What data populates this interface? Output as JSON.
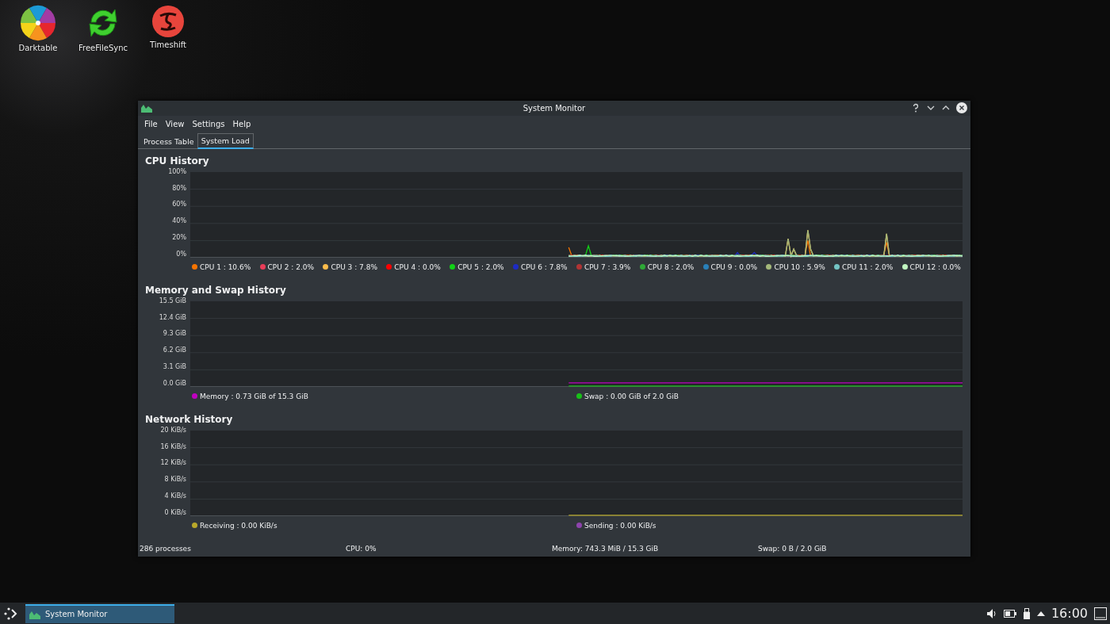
{
  "desktop_icons": [
    {
      "kind": "aperture",
      "label": "Darktable"
    },
    {
      "kind": "sync",
      "label": "FreeFileSync"
    },
    {
      "kind": "timeshift",
      "label": "Timeshift"
    }
  ],
  "window": {
    "title": "System Monitor"
  },
  "menu": [
    "File",
    "View",
    "Settings",
    "Help"
  ],
  "tabs": [
    {
      "label": "Process Table",
      "selected": false
    },
    {
      "label": "System Load",
      "selected": true
    }
  ],
  "panels": [
    {
      "kind": "cpu",
      "title": "CPU History",
      "y_labels": [
        "100%",
        "80%",
        "60%",
        "40%",
        "20%",
        "0%"
      ],
      "legend": [
        {
          "label": "CPU 1 : 10.6%",
          "color": "#f67400"
        },
        {
          "label": "CPU 2 : 2.0%",
          "color": "#e93d58"
        },
        {
          "label": "CPU 3 : 7.8%",
          "color": "#fdbc4b"
        },
        {
          "label": "CPU 4 : 0.0%",
          "color": "#ff0000"
        },
        {
          "label": "CPU 5 : 2.0%",
          "color": "#11d116"
        },
        {
          "label": "CPU 6 : 7.8%",
          "color": "#1d2bc4"
        },
        {
          "label": "CPU 7 : 3.9%",
          "color": "#b03434"
        },
        {
          "label": "CPU 8 : 2.0%",
          "color": "#2ea836"
        },
        {
          "label": "CPU 9 : 0.0%",
          "color": "#2980b9"
        },
        {
          "label": "CPU 10 : 5.9%",
          "color": "#a4b87a"
        },
        {
          "label": "CPU 11 : 2.0%",
          "color": "#73c4c4"
        },
        {
          "label": "CPU 12 : 0.0%",
          "color": "#c0f5c0"
        }
      ]
    },
    {
      "kind": "memory",
      "title": "Memory and Swap History",
      "y_labels": [
        "15.5 GiB",
        "12.4 GiB",
        "9.3 GiB",
        "6.2 GiB",
        "3.1 GiB",
        "0.0 GiB"
      ],
      "legend": [
        {
          "label": "Memory : 0.73 GiB of 15.3 GiB",
          "color": "#c000c0"
        },
        {
          "label": "Swap : 0.00 GiB of 2.0 GiB",
          "color": "#18c018"
        }
      ]
    },
    {
      "kind": "network",
      "title": "Network History",
      "y_labels": [
        "20 KiB/s",
        "16 KiB/s",
        "12 KiB/s",
        "8 KiB/s",
        "4 KiB/s",
        "0 KiB/s"
      ],
      "legend": [
        {
          "label": "Receiving : 0.00 KiB/s",
          "color": "#b8a82a"
        },
        {
          "label": "Sending : 0.00 KiB/s",
          "color": "#8e44ad"
        }
      ]
    }
  ],
  "status_bar": [
    "286 processes",
    "CPU: 0%",
    "Memory: 743.3 MiB / 15.3 GiB",
    "Swap: 0 B / 2.0 GiB"
  ],
  "taskbar": {
    "task": "System Monitor",
    "clock": "16:00"
  }
}
